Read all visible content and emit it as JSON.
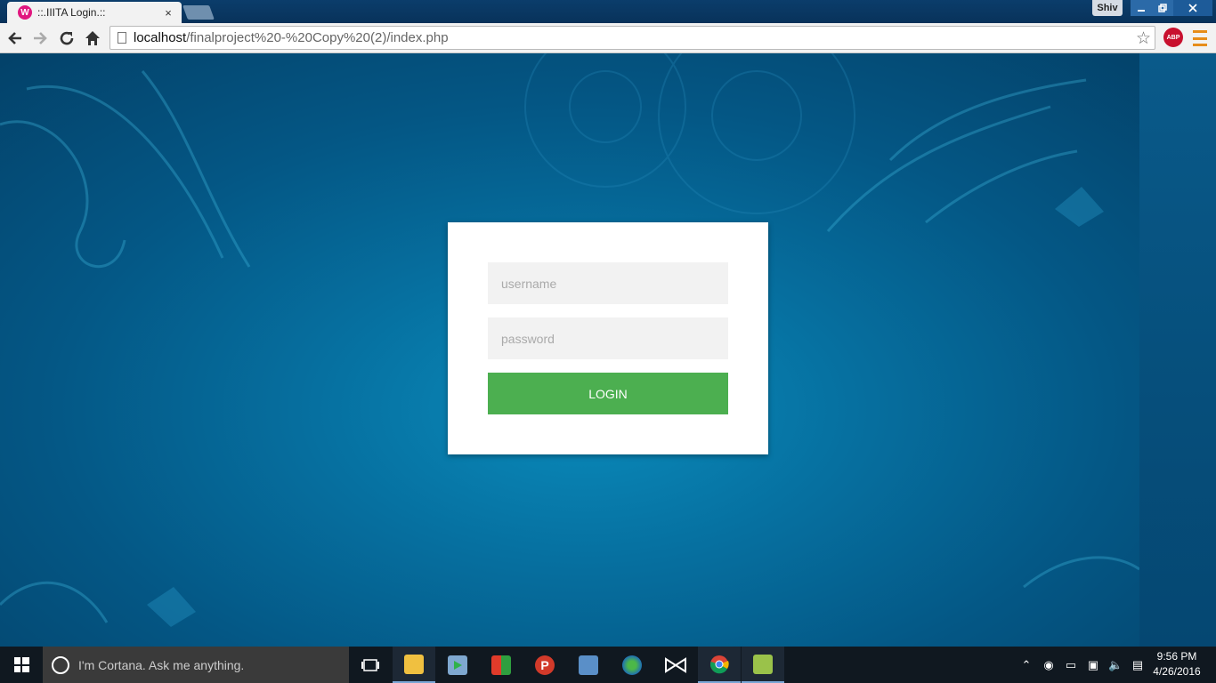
{
  "browser": {
    "tab_title": "::.IIITA Login.::",
    "favicon_glyph": "W",
    "tab_close": "×",
    "user_name": "Shiv",
    "url_host": "localhost",
    "url_path": "/finalproject%20-%20Copy%20(2)/index.php",
    "extension_badge": "ABP"
  },
  "login": {
    "username_placeholder": "username",
    "password_placeholder": "password",
    "button_label": "LOGIN",
    "button_color": "#4caf50"
  },
  "taskbar": {
    "search_placeholder": "I'm Cortana. Ask me anything.",
    "time": "9:56 PM",
    "date": "4/26/2016"
  }
}
